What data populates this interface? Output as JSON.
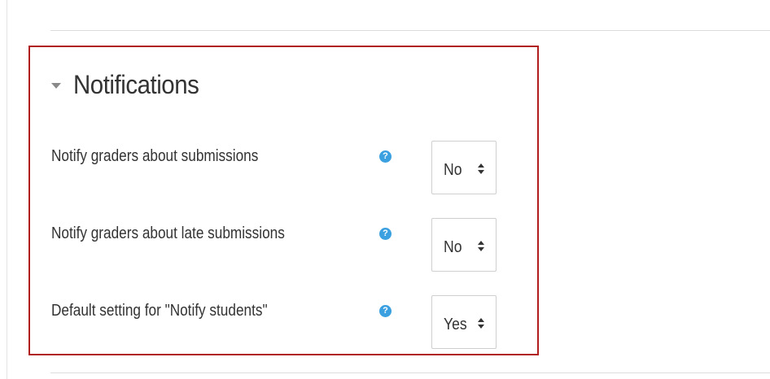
{
  "section": {
    "title": "Notifications",
    "expanded": true,
    "highlight_color": "#b01e1e"
  },
  "fields": [
    {
      "label": "Notify graders about submissions",
      "help_icon": "question-circle-icon",
      "help_glyph": "?",
      "value": "No"
    },
    {
      "label": "Notify graders about late submissions",
      "help_icon": "question-circle-icon",
      "help_glyph": "?",
      "value": "No"
    },
    {
      "label": "Default setting for \"Notify students\"",
      "help_icon": "question-circle-icon",
      "help_glyph": "?",
      "value": "Yes"
    }
  ],
  "colors": {
    "help_icon": "#3ba0e0",
    "text": "#333333"
  }
}
